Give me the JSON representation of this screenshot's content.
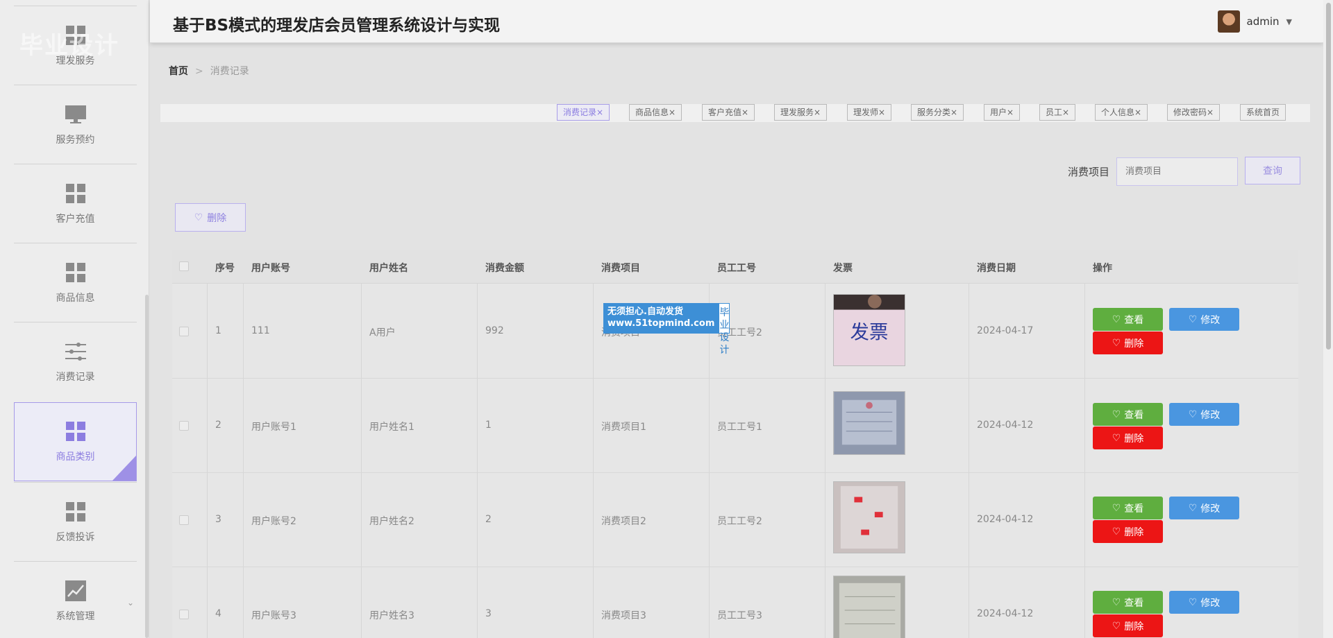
{
  "app": {
    "title": "基于BS模式的理发店会员管理系统设计与实现",
    "user": "admin"
  },
  "sidebar": {
    "items": [
      {
        "label": "理发服务",
        "icon": "grid-icon"
      },
      {
        "label": "服务预约",
        "icon": "monitor-icon"
      },
      {
        "label": "客户充值",
        "icon": "grid-icon"
      },
      {
        "label": "商品信息",
        "icon": "grid-icon"
      },
      {
        "label": "消费记录",
        "icon": "sliders-icon"
      },
      {
        "label": "商品类别",
        "icon": "grid-icon",
        "active": true
      },
      {
        "label": "反馈投诉",
        "icon": "grid-icon"
      },
      {
        "label": "系统管理",
        "icon": "chart-icon"
      }
    ]
  },
  "breadcrumb": {
    "home": "首页",
    "separator": ">",
    "current": "消费记录"
  },
  "tabs": [
    "消费记录×",
    "商品信息×",
    "客户充值×",
    "理发服务×",
    "理发师×",
    "服务分类×",
    "用户×",
    "员工×",
    "个人信息×",
    "修改密码×",
    "系统首页"
  ],
  "search": {
    "label": "消费项目",
    "placeholder": "消费项目",
    "button": "查询"
  },
  "toolbar": {
    "delete_label": "删除"
  },
  "table": {
    "headers": [
      "序号",
      "用户账号",
      "用户姓名",
      "消费金额",
      "消费项目",
      "员工工号",
      "发票",
      "消费日期",
      "操作"
    ],
    "rows": [
      {
        "no": "1",
        "account": "111",
        "name": "A用户",
        "amount": "992",
        "item": "消费项目",
        "staff": "员工工号2",
        "date": "2024-04-17"
      },
      {
        "no": "2",
        "account": "用户账号1",
        "name": "用户姓名1",
        "amount": "1",
        "item": "消费项目1",
        "staff": "员工工号1",
        "date": "2024-04-12"
      },
      {
        "no": "3",
        "account": "用户账号2",
        "name": "用户姓名2",
        "amount": "2",
        "item": "消费项目2",
        "staff": "员工工号2",
        "date": "2024-04-12"
      },
      {
        "no": "4",
        "account": "用户账号3",
        "name": "用户姓名3",
        "amount": "3",
        "item": "消费项目3",
        "staff": "员工工号3",
        "date": "2024-04-12"
      }
    ],
    "actions": {
      "view": "查看",
      "edit": "修改",
      "delete": "删除"
    }
  },
  "invoice_text": "发票",
  "watermark": "毕业设计",
  "ad": {
    "line1": "无须担心.自动发货",
    "line2": "www.51topmind.com",
    "side1": "毕业",
    "side2": "设计"
  },
  "colors": {
    "accent": "#8c7de0",
    "view": "#5fae3f",
    "edit": "#4a96e0",
    "delete": "#ec1515"
  }
}
